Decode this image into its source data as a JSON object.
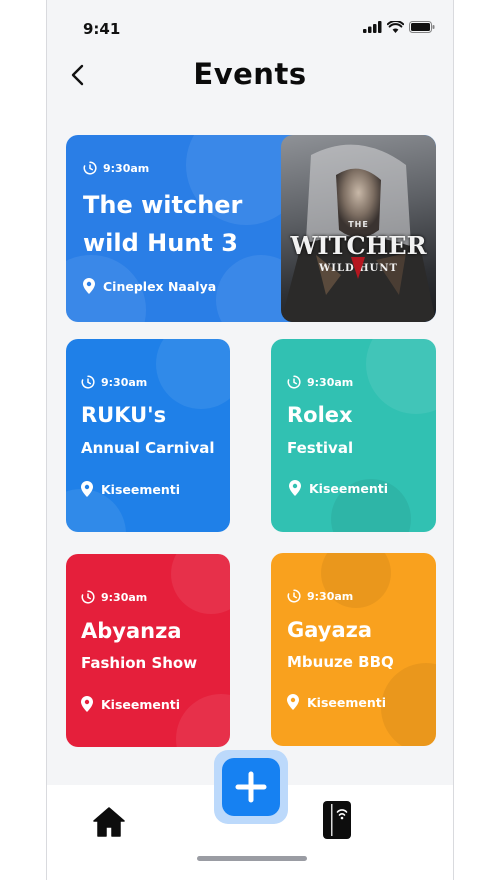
{
  "status_bar": {
    "time": "9:41"
  },
  "header": {
    "title": "Events"
  },
  "colors": {
    "featured": "#2a7ee6",
    "ruku": "#1f80e8",
    "rolex": "#31c1b2",
    "abyanza": "#e51f3b",
    "gayaza": "#f9a11e",
    "fab": "#1681f2"
  },
  "featured": {
    "time": "9:30am",
    "title_line1": "The witcher",
    "title_line2": "wild Hunt 3",
    "location": "Cineplex Naalya",
    "image_text_small": "THE",
    "image_text_big": "WITCHER",
    "image_text_sub": "WILD HUNT"
  },
  "events": [
    {
      "time": "9:30am",
      "title": "RUKU's",
      "subtitle": "Annual Carnival",
      "location": "Kiseementi"
    },
    {
      "time": "9:30am",
      "title": "Rolex",
      "subtitle": "Festival",
      "location": "Kiseementi"
    },
    {
      "time": "9:30am",
      "title": "Abyanza",
      "subtitle": "Fashion Show",
      "location": "Kiseementi"
    },
    {
      "time": "9:30am",
      "title": "Gayaza",
      "subtitle": "Mbuuze BBQ",
      "location": "Kiseementi"
    }
  ],
  "icons": {
    "back": "chevron-left-icon",
    "time": "clock-icon",
    "location": "location-pin-icon",
    "home": "home-icon",
    "add": "plus-icon",
    "device": "device-icon"
  }
}
